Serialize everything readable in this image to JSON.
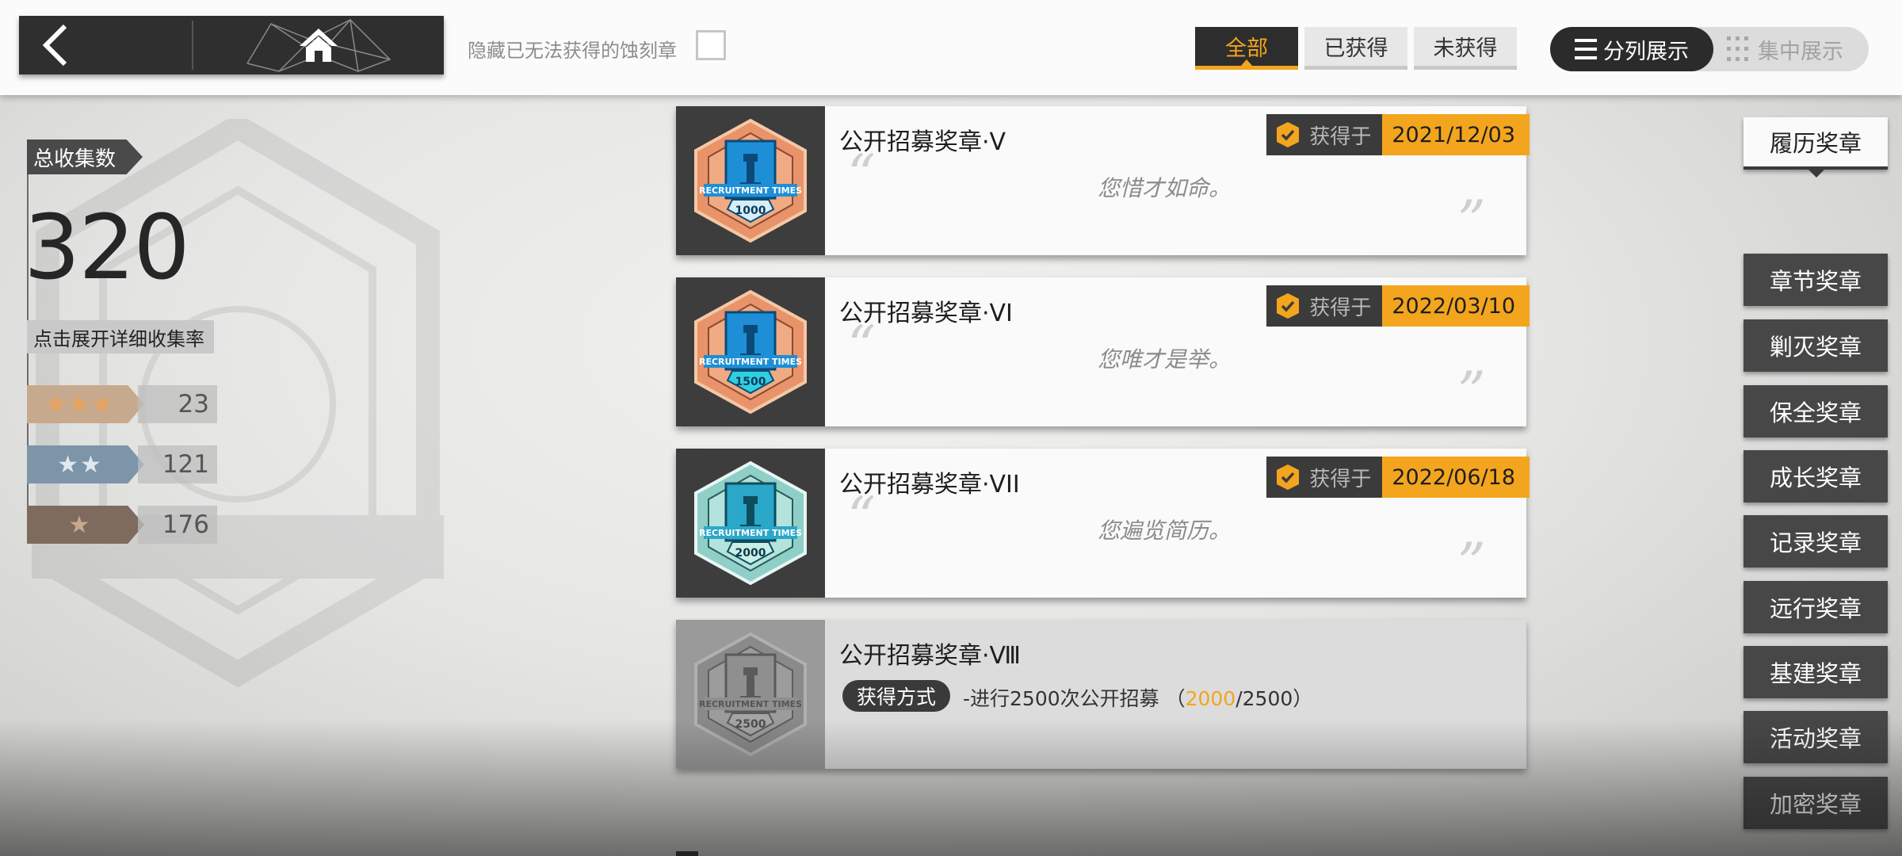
{
  "top": {
    "hide_label": "隐藏已无法获得的蚀刻章",
    "filters": [
      {
        "label": "全部",
        "active": true
      },
      {
        "label": "已获得",
        "active": false
      },
      {
        "label": "未获得",
        "active": false
      }
    ],
    "view_toggle": {
      "split": "分列展示",
      "grouped": "集中展示"
    }
  },
  "stats": {
    "total_label": "总收集数",
    "total": "320",
    "detail_link": "点击展开详细收集率",
    "rarity": [
      {
        "stars": "★★★",
        "count": "23",
        "color": "#e9a35e"
      },
      {
        "stars": "★★",
        "count": "121",
        "color": "#8fa9be"
      },
      {
        "stars": "★",
        "count": "176",
        "color": "#a58872"
      }
    ]
  },
  "medals": [
    {
      "title": "公开招募奖章·V",
      "obtained_label": "获得于",
      "date": "2021/12/03",
      "quote": "您惜才如命。",
      "icon_text": "1000",
      "icon": "recruitment-medal-orange-icon"
    },
    {
      "title": "公开招募奖章·VI",
      "obtained_label": "获得于",
      "date": "2022/03/10",
      "quote": "您唯才是举。",
      "icon_text": "1500",
      "icon": "recruitment-medal-orange-icon"
    },
    {
      "title": "公开招募奖章·VII",
      "obtained_label": "获得于",
      "date": "2022/06/18",
      "quote": "您遍览简历。",
      "icon_text": "2000",
      "icon": "recruitment-medal-teal-icon"
    },
    {
      "title": "公开招募奖章·Ⅷ",
      "method_label": "获得方式",
      "method_text": "-进行2500次公开招募 （",
      "progress": "2000",
      "target": "/2500）",
      "icon_text": "2500",
      "icon": "recruitment-medal-locked-icon"
    }
  ],
  "medal_icon_banner": "RECRUITMENT TIMES",
  "categories": [
    {
      "label": "履历奖章",
      "active": true
    },
    {
      "label": "章节奖章"
    },
    {
      "label": "剿灭奖章"
    },
    {
      "label": "保全奖章"
    },
    {
      "label": "成长奖章"
    },
    {
      "label": "记录奖章"
    },
    {
      "label": "远行奖章"
    },
    {
      "label": "基建奖章"
    },
    {
      "label": "活动奖章"
    },
    {
      "label": "加密奖章"
    }
  ],
  "colors": {
    "accent": "#f3a51e",
    "dark": "#2d2d2d"
  }
}
